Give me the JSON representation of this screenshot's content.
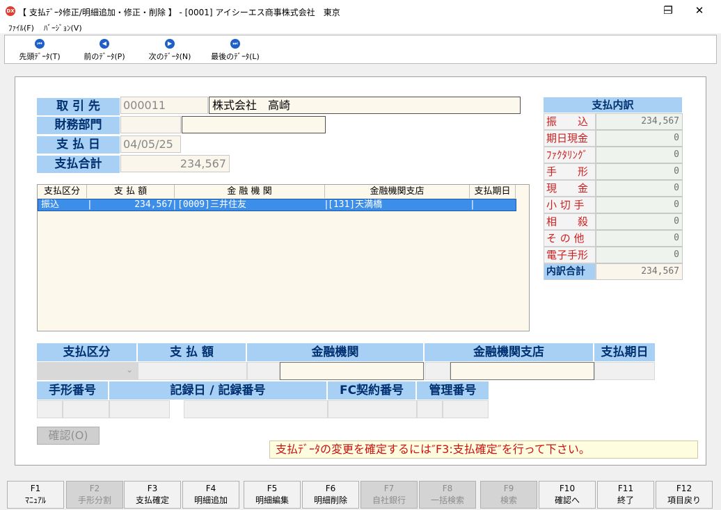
{
  "window": {
    "title": "【 支払ﾃﾞｰﾀ修正/明細追加・修正・削除 】 - [0001] アイシーエス商事株式会社　東京",
    "icon": "DX",
    "min": "─",
    "max": "❐",
    "close": "✕"
  },
  "menu": [
    "ﾌｧｲﾙ(F)",
    "ﾊﾞｰｼﾞｮﾝ(V)"
  ],
  "toolbar": [
    {
      "label": "先頭ﾃﾞｰﾀ(T)",
      "icon": "first-record-icon",
      "glyph": "⏮"
    },
    {
      "label": "前のﾃﾞｰﾀ(P)",
      "icon": "prev-record-icon",
      "glyph": "◀"
    },
    {
      "label": "次のﾃﾞｰﾀ(N)",
      "icon": "next-record-icon",
      "glyph": "▶"
    },
    {
      "label": "最後のﾃﾞｰﾀ(L)",
      "icon": "last-record-icon",
      "glyph": "⏭"
    }
  ],
  "header": {
    "client_label": "取 引 先",
    "client_code": "000011",
    "client_name": "株式会社　高崎",
    "finance_label": "財務部門",
    "finance_code": "",
    "finance_name": "",
    "date_label": "支 払 日",
    "date_value": "04/05/25",
    "total_label": "支払合計",
    "total_value": "234,567"
  },
  "grid": {
    "columns": [
      "支払区分",
      "支 払 額",
      "金 融 機 関",
      "金融機関支店",
      "支払期日"
    ],
    "rows": [
      {
        "type": "振込",
        "amount": "234,567",
        "bank": "[0009]三井住友",
        "branch": "[131]天満橋",
        "due": ""
      }
    ]
  },
  "breakdown": {
    "title": "支払内訳",
    "items": [
      {
        "label": "振　　込",
        "value": "234,567"
      },
      {
        "label": "期日現金",
        "value": "0"
      },
      {
        "label": "ﾌｧｸﾀﾘﾝｸﾞ",
        "value": "0"
      },
      {
        "label": "手　　形",
        "value": "0"
      },
      {
        "label": "現　　金",
        "value": "0"
      },
      {
        "label": "小 切 手",
        "value": "0"
      },
      {
        "label": "相　　殺",
        "value": "0"
      },
      {
        "label": "そ の 他",
        "value": "0"
      },
      {
        "label": "電子手形",
        "value": "0"
      }
    ],
    "total_label": "内訳合計",
    "total_value": "234,567"
  },
  "detail": {
    "labels1": [
      "支払区分",
      "支 払 額",
      "金融機関",
      "金融機関支店",
      "支払期日"
    ],
    "labels2": [
      "手形番号",
      "記録日 / 記録番号",
      "FC契約番号",
      "管理番号"
    ],
    "dropdown_glyph": "⌄"
  },
  "confirm_label": "確認(O)",
  "message": "支払ﾃﾞｰﾀの変更を確定するには″F3:支払確定″を行って下さい。",
  "fkeys": [
    {
      "key": "F1",
      "label": "ﾏﾆｭｱﾙ",
      "enabled": true
    },
    {
      "key": "F2",
      "label": "手形分割",
      "enabled": false
    },
    {
      "key": "F3",
      "label": "支払確定",
      "enabled": true
    },
    {
      "key": "F4",
      "label": "明細追加",
      "enabled": true
    },
    {
      "key": "F5",
      "label": "明細編集",
      "enabled": true
    },
    {
      "key": "F6",
      "label": "明細削除",
      "enabled": true
    },
    {
      "key": "F7",
      "label": "自社銀行",
      "enabled": false
    },
    {
      "key": "F8",
      "label": "一括検索",
      "enabled": false
    },
    {
      "key": "F9",
      "label": "検索",
      "enabled": false
    },
    {
      "key": "F10",
      "label": "確認へ",
      "enabled": true
    },
    {
      "key": "F11",
      "label": "終了",
      "enabled": true
    },
    {
      "key": "F12",
      "label": "項目戻り",
      "enabled": true
    }
  ]
}
